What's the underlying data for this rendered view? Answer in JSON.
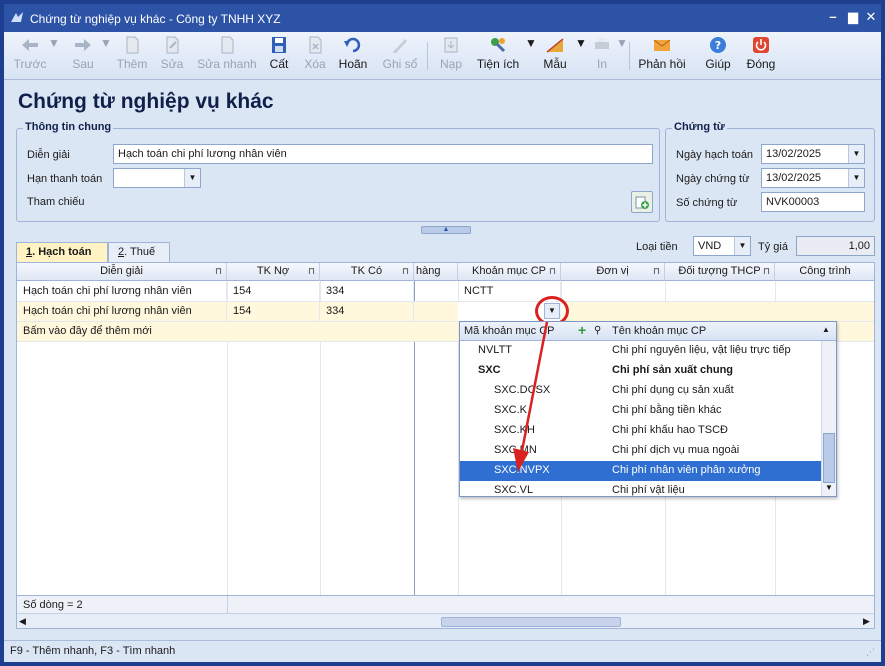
{
  "window": {
    "title": "Chứng từ nghiệp vụ khác - Công ty TNHH XYZ"
  },
  "toolbar": {
    "back": "Trước",
    "forward": "Sau",
    "add": "Thêm",
    "edit": "Sửa",
    "quick_edit": "Sửa nhanh",
    "save": "Cất",
    "delete": "Xóa",
    "undo": "Hoãn",
    "post": "Ghi sổ",
    "load": "Nạp",
    "utilities": "Tiện ích",
    "template": "Mẫu",
    "print": "In",
    "feedback": "Phản hồi",
    "help": "Giúp",
    "close": "Đóng"
  },
  "page_title": "Chứng từ nghiệp vụ khác",
  "general_info": {
    "legend": "Thông tin chung",
    "description_label": "Diễn giải",
    "description_value": "Hạch toán chi phí lương nhân viên",
    "due_label": "Hạn thanh toán",
    "due_value": "",
    "reference_label": "Tham chiếu"
  },
  "voucher": {
    "legend": "Chứng từ",
    "posting_date_label": "Ngày hạch toán",
    "posting_date_value": "13/02/2025",
    "voucher_date_label": "Ngày chứng từ",
    "voucher_date_value": "13/02/2025",
    "voucher_no_label": "Số chứng từ",
    "voucher_no_value": "NVK00003"
  },
  "tabs": [
    {
      "num": "1",
      "label": ". Hạch toán",
      "active": true
    },
    {
      "num": "2",
      "label": ". Thuế",
      "active": false
    }
  ],
  "currency": {
    "label": "Loại tiền",
    "value": "VND",
    "rate_label": "Tỷ giá",
    "rate_value": "1,00"
  },
  "grid": {
    "columns": [
      "Diễn giải",
      "TK Nợ",
      "TK Có",
      "hàng",
      "Khoản mục CP",
      "Đơn vị",
      "Đối tượng THCP",
      "Công trình"
    ],
    "rows": [
      {
        "desc": "Hạch toán chi phí lương nhân viên",
        "debit": "154",
        "credit": "334",
        "cost_item": "NCTT"
      },
      {
        "desc": "Hạch toán chi phí lương nhân viên",
        "debit": "154",
        "credit": "334",
        "cost_item": ""
      }
    ],
    "add_new": "Bấm vào đây để thêm mới",
    "row_count": "Số dòng = 2"
  },
  "popup": {
    "code_header": "Mã khoản mục CP",
    "name_header": "Tên khoản mục CP",
    "items": [
      {
        "code": "NVLTT",
        "name": "Chi phí nguyên liệu, vật liệu trực tiếp",
        "level": 1,
        "bold": false,
        "selected": false
      },
      {
        "code": "SXC",
        "name": "Chi phí sản xuất chung",
        "level": 1,
        "bold": true,
        "selected": false
      },
      {
        "code": "SXC.DCSX",
        "name": "Chi phí dụng cụ sản xuất",
        "level": 2,
        "bold": false,
        "selected": false
      },
      {
        "code": "SXC.K",
        "name": "Chi phí bằng tiền khác",
        "level": 2,
        "bold": false,
        "selected": false
      },
      {
        "code": "SXC.KH",
        "name": "Chi phí khấu hao TSCĐ",
        "level": 2,
        "bold": false,
        "selected": false
      },
      {
        "code": "SXC.MN",
        "name": "Chi phí dịch vụ mua ngoài",
        "level": 2,
        "bold": false,
        "selected": false
      },
      {
        "code": "SXC.NVPX",
        "name": "Chi phí nhân viên phân xưởng",
        "level": 2,
        "bold": false,
        "selected": true
      },
      {
        "code": "SXC.VL",
        "name": "Chi phí vật liệu",
        "level": 2,
        "bold": false,
        "selected": false
      }
    ]
  },
  "status": {
    "hint": "F9 - Thêm nhanh, F3 - Tìm nhanh"
  },
  "colors": {
    "title_bar": "#2c53a6",
    "selection": "#2f6fd1",
    "highlight_circle": "#d9221f",
    "arrow": "#d9221f",
    "active_row": "#fff8dc"
  }
}
